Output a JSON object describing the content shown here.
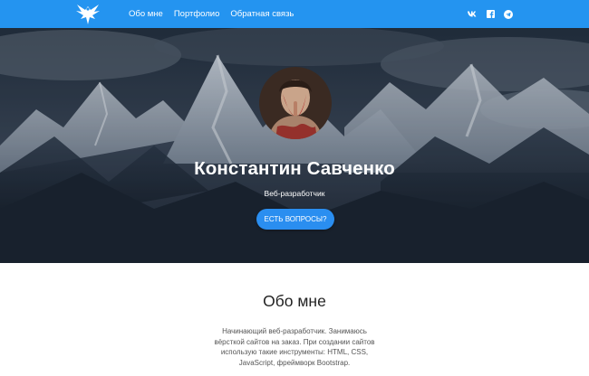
{
  "nav": {
    "logo_icon": "eagle-logo-icon",
    "links": [
      {
        "label": "Обо мне"
      },
      {
        "label": "Портфолио"
      },
      {
        "label": "Обратная связь"
      }
    ],
    "socials": [
      {
        "icon": "vk-icon"
      },
      {
        "icon": "facebook-icon"
      },
      {
        "icon": "telegram-icon"
      }
    ],
    "bg_color": "#2494f0"
  },
  "hero": {
    "name": "Константин Савченко",
    "role": "Веб-разработчик",
    "cta_label": "ЕСТЬ ВОПРОСЫ?",
    "cta_color": "#2a8ef0",
    "background_icon": "mountain-landscape-image",
    "avatar_icon": "profile-photo"
  },
  "about": {
    "title": "Обо мне",
    "text": "Начинающий веб-разработчик. Занимаюсь вёрсткой сайтов на заказ. При создании сайтов использую такие инструменты: HTML, CSS, JavaScript, фреймворк Bootstrap."
  }
}
